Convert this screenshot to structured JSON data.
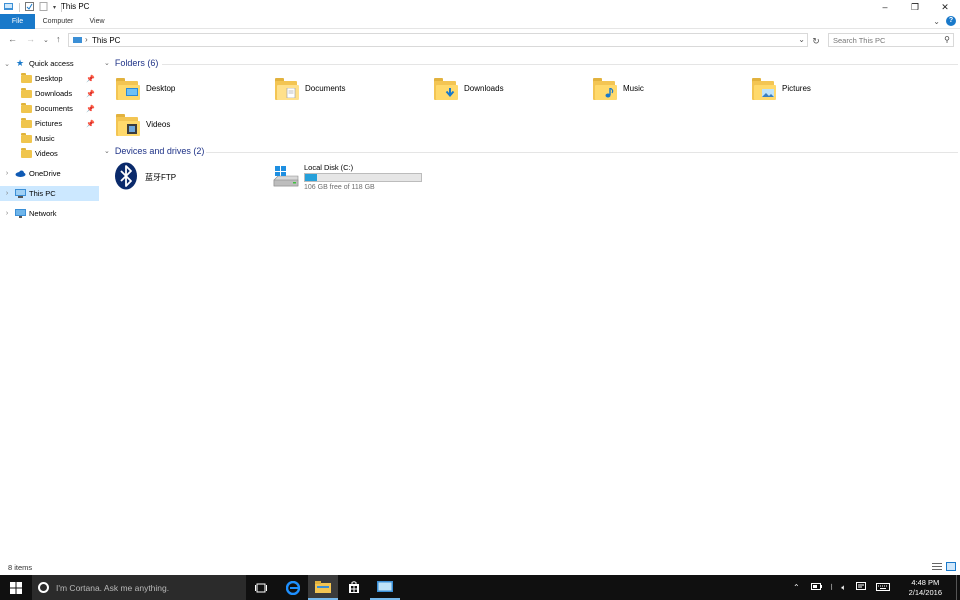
{
  "window": {
    "title": "This PC",
    "controls": {
      "minimize": "–",
      "maximize": "❐",
      "close": "✕"
    }
  },
  "ribbon": {
    "tabs": [
      "File",
      "Computer",
      "View"
    ]
  },
  "address": {
    "path": "This PC",
    "search_placeholder": "Search This PC"
  },
  "navpane": {
    "quick_access": "Quick access",
    "quick_items": [
      "Desktop",
      "Downloads",
      "Documents",
      "Pictures",
      "Music",
      "Videos"
    ],
    "onedrive": "OneDrive",
    "this_pc": "This PC",
    "network": "Network"
  },
  "content": {
    "folders_header": "Folders (6)",
    "folders": [
      "Desktop",
      "Documents",
      "Downloads",
      "Music",
      "Pictures",
      "Videos"
    ],
    "devices_header": "Devices and drives (2)",
    "bluetooth": "蓝牙FTP",
    "drive": {
      "name": "Local Disk (C:)",
      "free_text": "106 GB free of 118 GB",
      "used_fraction": 0.102
    }
  },
  "status": {
    "items": "8 items"
  },
  "taskbar": {
    "cortana_placeholder": "I'm Cortana. Ask me anything.",
    "time": "4:48 PM",
    "date": "2/14/2016"
  },
  "colors": {
    "accent": "#1979ca",
    "selection": "#cce8ff",
    "section_header": "#1e3287",
    "drive_fill": "#26a0da",
    "taskbar": "#101010"
  }
}
